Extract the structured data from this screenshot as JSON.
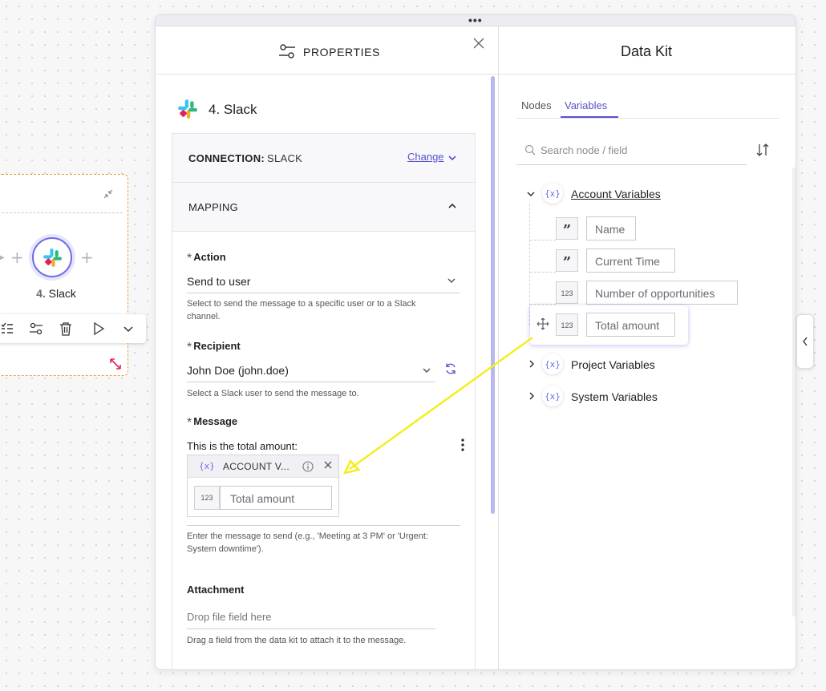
{
  "canvas": {
    "node_number": "4.",
    "node_name": "Slack"
  },
  "properties": {
    "title": "PROPERTIES",
    "node_title": "4. Slack",
    "connection_label": "CONNECTION:",
    "connection_value": "SLACK",
    "change_label": "Change",
    "mapping_label": "MAPPING",
    "action_label": "Action",
    "action_value": "Send to user",
    "action_help": "Select to send the message to a specific user or to a Slack channel.",
    "recipient_label": "Recipient",
    "recipient_value": "John Doe (john.doe)",
    "recipient_help": "Select a Slack user to send the message to.",
    "message_label": "Message",
    "message_text": "This is the total amount:",
    "token_header": "ACCOUNT V...",
    "token_type": "123",
    "token_value": "Total amount",
    "message_help": "Enter the message to send (e.g., 'Meeting at 3 PM' or 'Urgent: System downtime').",
    "attachment_label": "Attachment",
    "attachment_placeholder": "Drop file field here",
    "attachment_help": "Drag a field from the data kit to attach it to the message."
  },
  "data_kit": {
    "title": "Data Kit",
    "tabs": [
      "Nodes",
      "Variables"
    ],
    "active_tab": "Variables",
    "search_placeholder": "Search node / field",
    "groups": [
      {
        "name": "Account Variables",
        "expanded": true,
        "items": [
          {
            "type": "text",
            "type_label": "”",
            "name": "Name"
          },
          {
            "type": "text",
            "type_label": "”",
            "name": "Current Time"
          },
          {
            "type": "number",
            "type_label": "123",
            "name": "Number of opportunities"
          },
          {
            "type": "number",
            "type_label": "123",
            "name": "Total amount",
            "dragging": true
          }
        ]
      },
      {
        "name": "Project Variables",
        "expanded": false
      },
      {
        "name": "System Variables",
        "expanded": false
      }
    ]
  },
  "colors": {
    "accent": "#5753c9",
    "drag_arrow": "#f5ee1c",
    "node_border": "#e9a23b"
  }
}
